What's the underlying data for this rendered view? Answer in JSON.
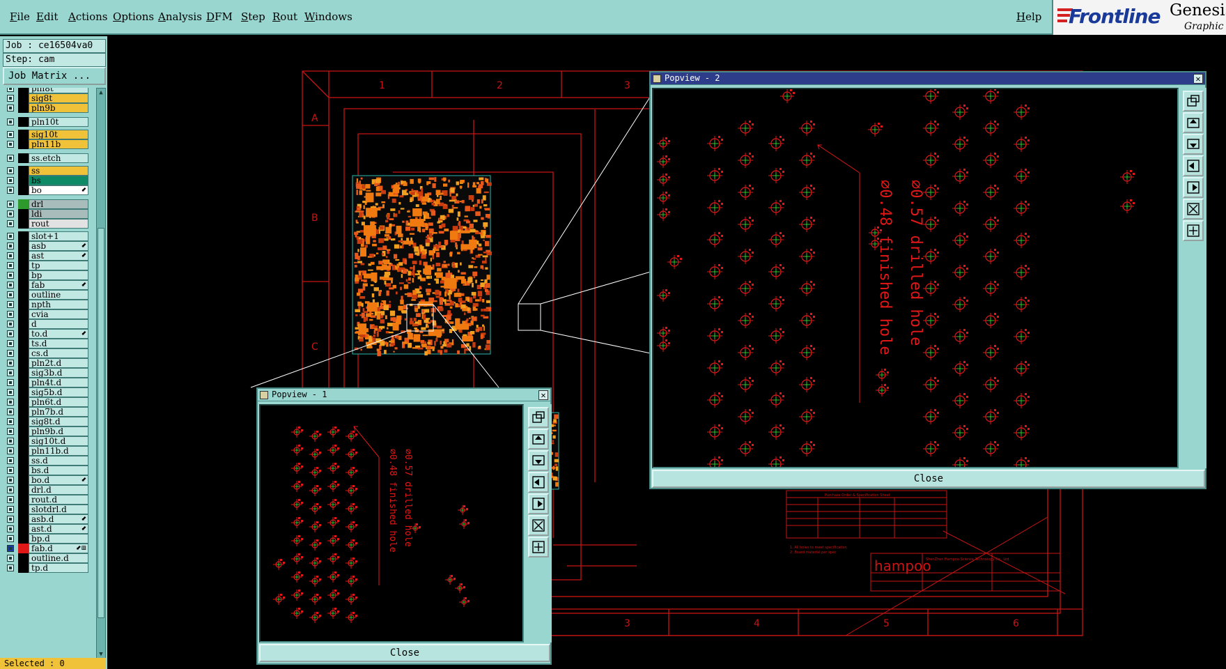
{
  "menubar": {
    "items": [
      "File",
      "Edit",
      "Actions",
      "Options",
      "Analysis",
      "DFM",
      "Step",
      "Rout",
      "Windows"
    ],
    "help": "Help"
  },
  "logo": {
    "brand": "Frontline",
    "product": "Genesis",
    "tagline": "Graphic E"
  },
  "left_panel": {
    "job": "Job : ce16504va0",
    "step": "Step: cam",
    "job_matrix_button": "Job Matrix ...",
    "layers": [
      {
        "name": "pln8t",
        "color": "#c2e8e4"
      },
      {
        "name": "sig8t",
        "color": "#f0c23a"
      },
      {
        "name": "pln9b",
        "color": "#f0c23a"
      },
      {
        "name": "pln10t",
        "color": "#c2e8e4"
      },
      {
        "name": "sig10t",
        "color": "#f0c23a"
      },
      {
        "name": "pln11b",
        "color": "#f0c23a"
      },
      {
        "name": "ss.etch",
        "color": "#c2e8e4"
      },
      {
        "name": "ss",
        "color": "#f0c23a"
      },
      {
        "name": "bs",
        "color": "#0e8a66"
      },
      {
        "name": "bo",
        "color": "#ffffff",
        "mark": "⬋"
      },
      {
        "name": "drl",
        "color": "#a8bcbc",
        "swatch": "#2e9a2e"
      },
      {
        "name": "ldi",
        "color": "#a8bcbc"
      },
      {
        "name": "rout",
        "color": "#e2e2e2"
      },
      {
        "name": "slot+1",
        "color": "#c2e8e4"
      },
      {
        "name": "asb",
        "color": "#c2e8e4",
        "mark": "⬋"
      },
      {
        "name": "ast",
        "color": "#c2e8e4",
        "mark": "⬋"
      },
      {
        "name": "tp",
        "color": "#c2e8e4"
      },
      {
        "name": "bp",
        "color": "#c2e8e4"
      },
      {
        "name": "fab",
        "color": "#c2e8e4",
        "mark": "⬋"
      },
      {
        "name": "outline",
        "color": "#c2e8e4"
      },
      {
        "name": "npth",
        "color": "#c2e8e4"
      },
      {
        "name": "cvia",
        "color": "#c2e8e4"
      },
      {
        "name": "d",
        "color": "#c2e8e4"
      },
      {
        "name": "to.d",
        "color": "#c2e8e4",
        "mark": "⬋"
      },
      {
        "name": "ts.d",
        "color": "#c2e8e4"
      },
      {
        "name": "cs.d",
        "color": "#c2e8e4"
      },
      {
        "name": "pln2t.d",
        "color": "#c2e8e4"
      },
      {
        "name": "sig3b.d",
        "color": "#c2e8e4"
      },
      {
        "name": "pln4t.d",
        "color": "#c2e8e4"
      },
      {
        "name": "sig5b.d",
        "color": "#c2e8e4"
      },
      {
        "name": "pln6t.d",
        "color": "#c2e8e4"
      },
      {
        "name": "pln7b.d",
        "color": "#c2e8e4"
      },
      {
        "name": "sig8t.d",
        "color": "#c2e8e4"
      },
      {
        "name": "pln9b.d",
        "color": "#c2e8e4"
      },
      {
        "name": "sig10t.d",
        "color": "#c2e8e4"
      },
      {
        "name": "pln11b.d",
        "color": "#c2e8e4"
      },
      {
        "name": "ss.d",
        "color": "#c2e8e4"
      },
      {
        "name": "bs.d",
        "color": "#c2e8e4"
      },
      {
        "name": "bo.d",
        "color": "#c2e8e4",
        "mark": "⬋"
      },
      {
        "name": "drl.d",
        "color": "#c2e8e4"
      },
      {
        "name": "rout.d",
        "color": "#c2e8e4"
      },
      {
        "name": "slotdrl.d",
        "color": "#c2e8e4"
      },
      {
        "name": "asb.d",
        "color": "#c2e8e4",
        "mark": "⬋"
      },
      {
        "name": "ast.d",
        "color": "#c2e8e4",
        "mark": "⬋"
      },
      {
        "name": "bp.d",
        "color": "#c2e8e4"
      },
      {
        "name": "fab.d",
        "color": "#c2e8e4",
        "mark": "⬋⊞",
        "swatch": "#e01818",
        "checked": true
      },
      {
        "name": "outline.d",
        "color": "#c2e8e4"
      },
      {
        "name": "tp.d",
        "color": "#c2e8e4"
      }
    ],
    "status": "Selected : 0"
  },
  "board": {
    "row_labels": [
      "A",
      "B",
      "C"
    ],
    "top_col_labels": [
      "1",
      "2",
      "3"
    ],
    "bottom_col_labels": [
      "3",
      "4",
      "5",
      "6"
    ],
    "company_logo": "hampoo"
  },
  "popview1": {
    "title": "Popview - 1",
    "close_label": "Close",
    "annotation_a": "0.57 drilled hole",
    "annotation_b": "0.48 finished hole"
  },
  "popview2": {
    "title": "Popview - 2",
    "close_label": "Close",
    "annotation_a": "0.57 drilled hole",
    "annotation_b": "0.48 finished hole"
  },
  "colors": {
    "ui_bg": "#9ad6d0",
    "field_bg": "#c2e8e4",
    "highlight_layer": "#f0c23a",
    "board_lines": "#e01818",
    "copper": "#f07a10",
    "active_title": "#2e3d8a"
  },
  "tool_icons": [
    "zoom-window-icon",
    "pan-up-icon",
    "pan-down-icon",
    "pan-left-icon",
    "pan-right-icon",
    "zoom-fit-icon",
    "zoom-home-icon"
  ]
}
